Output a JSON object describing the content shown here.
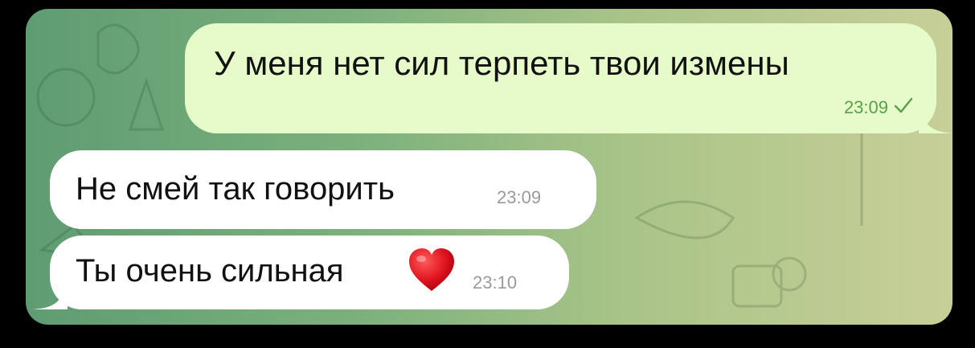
{
  "messages": [
    {
      "direction": "outgoing",
      "text": "У меня нет сил терпеть твои измены",
      "time": "23:09",
      "status_icon": "single-check-icon"
    },
    {
      "direction": "incoming",
      "text": "Не смей так говорить",
      "time": "23:09"
    },
    {
      "direction": "incoming",
      "text": "Ты очень сильная",
      "emoji": "red-heart-icon",
      "time": "23:10"
    }
  ],
  "colors": {
    "outgoing_bubble": "#e6fbc9",
    "incoming_bubble": "#ffffff",
    "outgoing_time": "#5aa04c",
    "incoming_time": "#9a9a9a",
    "wallpaper_left": "#5f9c72",
    "wallpaper_right": "#c7cf98"
  }
}
